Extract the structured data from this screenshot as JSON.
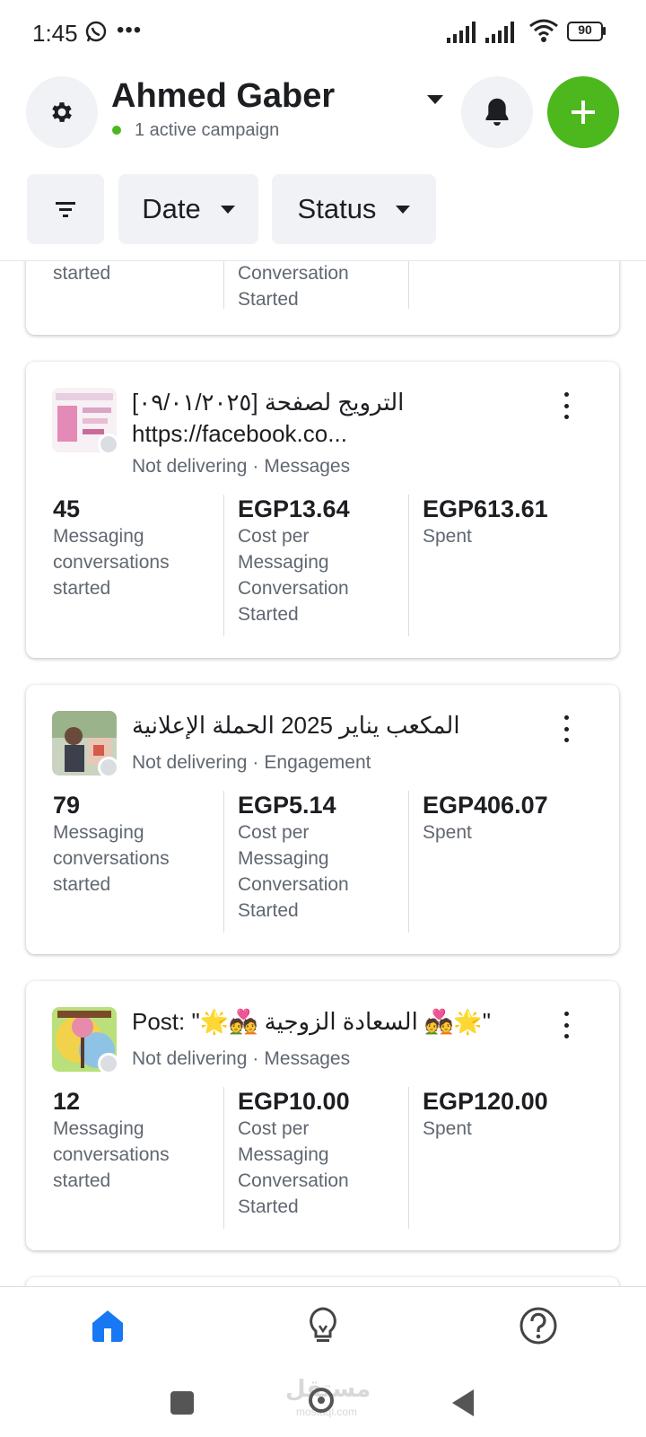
{
  "status_bar": {
    "time": "1:45",
    "battery": "90"
  },
  "header": {
    "account_name": "Ahmed Gaber",
    "account_status": "1 active campaign",
    "filters": {
      "date": "Date",
      "status": "Status"
    },
    "colors": {
      "accent_green": "#4cb81d"
    }
  },
  "partial_card": {
    "col1_label": "started",
    "col2_label": "Conversation\nStarted"
  },
  "campaigns": [
    {
      "title_line1": "[٠٩/٠١/٢٠٢٥] الترويج لصفحة",
      "title_line2": "https://facebook.co...",
      "status": "Not delivering",
      "objective": "Messages",
      "metrics": [
        {
          "value": "45",
          "label": "Messaging\nconversations\nstarted"
        },
        {
          "value": "EGP13.64",
          "label": "Cost per\nMessaging\nConversation\nStarted"
        },
        {
          "value": "EGP613.61",
          "label": "Spent"
        }
      ]
    },
    {
      "title_line1": "المكعب يناير 2025 الحملة الإعلانية",
      "status": "Not delivering",
      "objective": "Engagement",
      "metrics": [
        {
          "value": "79",
          "label": "Messaging\nconversations\nstarted"
        },
        {
          "value": "EGP5.14",
          "label": "Cost per\nMessaging\nConversation\nStarted"
        },
        {
          "value": "EGP406.07",
          "label": "Spent"
        }
      ]
    },
    {
      "title_line1": "Post: \"🌟💑 السعادة الزوجية 💑🌟\"",
      "status": "Not delivering",
      "objective": "Messages",
      "metrics": [
        {
          "value": "12",
          "label": "Messaging\nconversations\nstarted"
        },
        {
          "value": "EGP10.00",
          "label": "Cost per\nMessaging\nConversation\nStarted"
        },
        {
          "value": "EGP120.00",
          "label": "Spent"
        }
      ]
    }
  ],
  "bottom_nav": {
    "icons": [
      "home-icon",
      "lightbulb-icon",
      "help-icon"
    ],
    "active_color": "#1877f2"
  },
  "watermark": {
    "text": "مستقل",
    "sub": "mostaql.com"
  }
}
